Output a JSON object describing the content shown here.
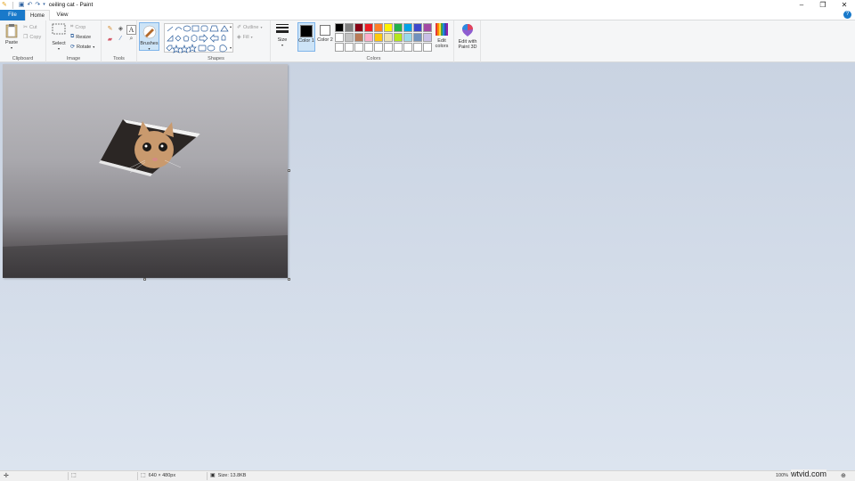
{
  "window": {
    "title": "ceiling cat - Paint",
    "controls": [
      "minimize-icon",
      "restore-icon",
      "close-icon"
    ]
  },
  "tabs": [
    {
      "label": "File",
      "active": false
    },
    {
      "label": "Home",
      "active": true
    },
    {
      "label": "View",
      "active": false
    }
  ],
  "ribbon": {
    "clipboard": {
      "label": "Clipboard",
      "paste": "Paste",
      "cut": "Cut",
      "copy": "Copy"
    },
    "image": {
      "label": "Image",
      "select": "Select",
      "crop": "Crop",
      "resize": "Resize",
      "rotate": "Rotate"
    },
    "tools": {
      "label": "Tools",
      "text_tool": "A"
    },
    "brushes": {
      "label": "Brushes"
    },
    "shapes": {
      "label": "Shapes",
      "outline": "Outline",
      "fill": "Fill"
    },
    "size": {
      "label": "Size"
    },
    "colors": {
      "label": "Colors",
      "color1": "Color 1",
      "color1_value": "#000000",
      "color2": "Color 2",
      "color2_value": "#ffffff",
      "edit_colors": "Edit colors",
      "palette": [
        "#000000",
        "#7f7f7f",
        "#880015",
        "#ed1c24",
        "#ff7f27",
        "#fff200",
        "#22b14c",
        "#00a2e8",
        "#3f48cc",
        "#a349a4",
        "#ffffff",
        "#c3c3c3",
        "#b97a57",
        "#ffaec9",
        "#ffc90e",
        "#efe4b0",
        "#b5e61d",
        "#99d9ea",
        "#7092be",
        "#c8bfe7",
        "#ffffff",
        "#ffffff",
        "#ffffff",
        "#ffffff",
        "#ffffff",
        "#ffffff",
        "#ffffff",
        "#ffffff",
        "#ffffff",
        "#ffffff"
      ]
    },
    "paint3d": {
      "label": "Edit with Paint 3D"
    }
  },
  "status": {
    "dimensions": "640 × 480px",
    "size": "Size: 13.8KB",
    "zoom": "100%"
  },
  "watermark": "wtvid.com"
}
